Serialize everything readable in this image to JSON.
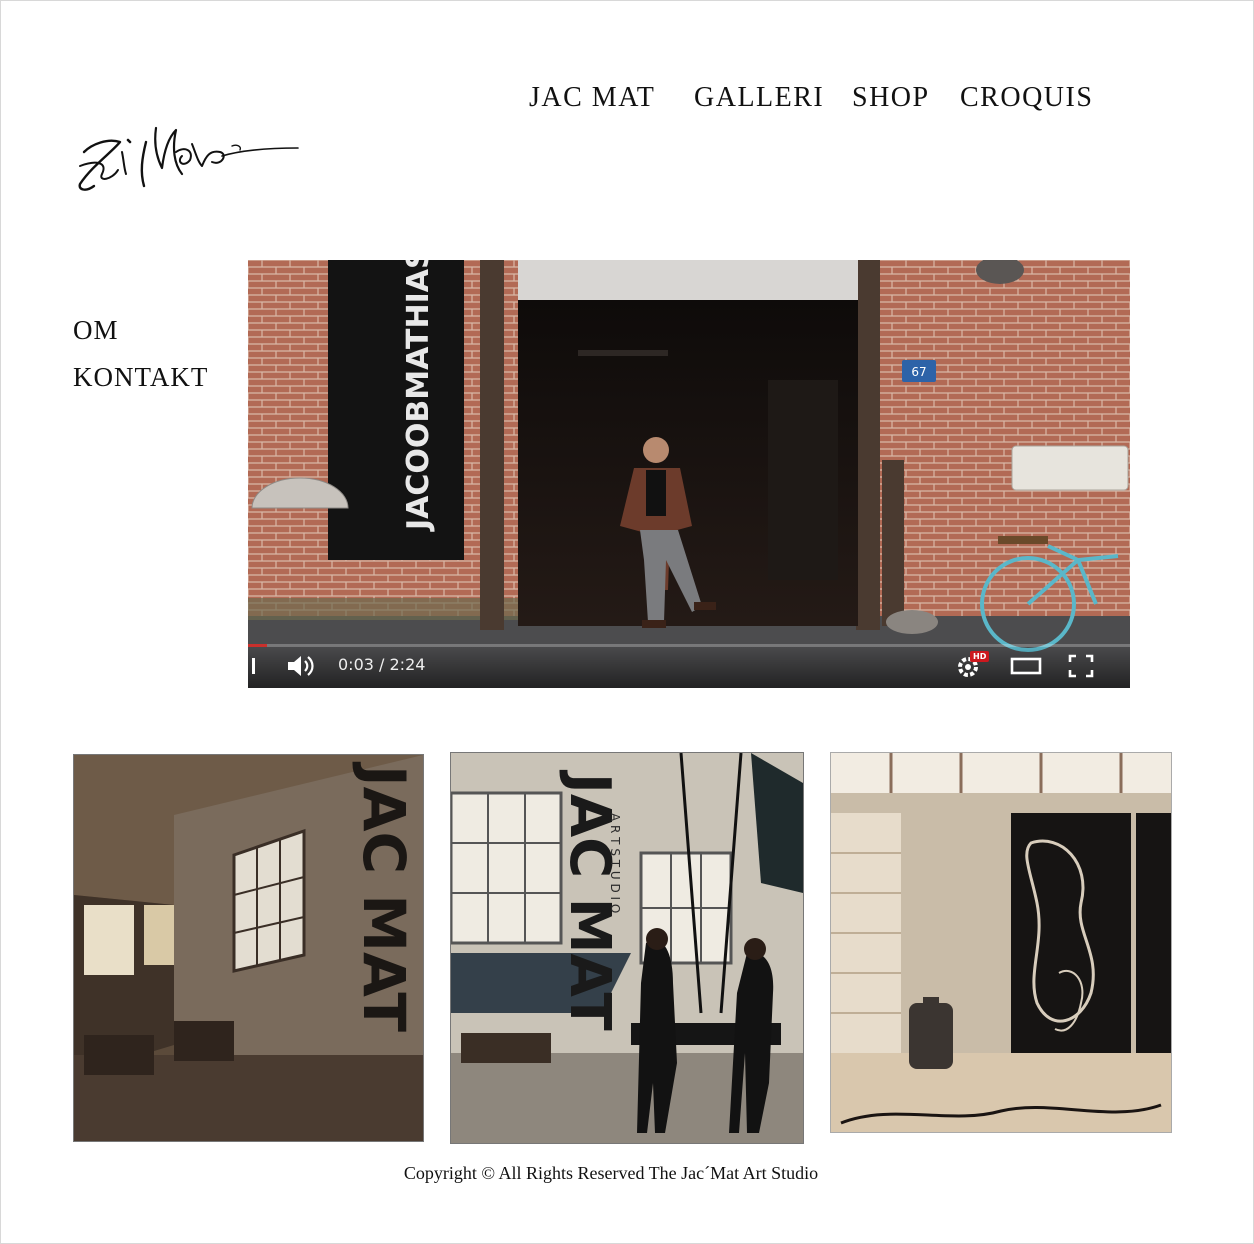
{
  "nav": {
    "items": [
      {
        "label": "JAC MAT"
      },
      {
        "label": "GALLERI"
      },
      {
        "label": "SHOP"
      },
      {
        "label": "CROQUIS"
      }
    ]
  },
  "side_menu": {
    "items": [
      {
        "label": "OM"
      },
      {
        "label": "KONTAKT"
      }
    ]
  },
  "video": {
    "banner_text": "JACOOBMATHIAS.COM",
    "house_number": "67",
    "time": "0:03 / 2:24",
    "progress_fraction": 0.021,
    "hd_badge": "HD",
    "icons": [
      "volume-icon",
      "settings-icon",
      "theater-mode-icon",
      "fullscreen-icon"
    ]
  },
  "photos": {
    "one_wall_text": "JAC MAT",
    "two_wall_text": "JAC MAT",
    "two_wall_small": "A R T S T U D I O"
  },
  "footer": {
    "text": "Copyright ©  All Rights Reserved The Jac´Mat Art Studio"
  },
  "colors": {
    "brick": "#b26a55",
    "progress": "#c9302c",
    "bicycle": "#5ab7c9"
  }
}
